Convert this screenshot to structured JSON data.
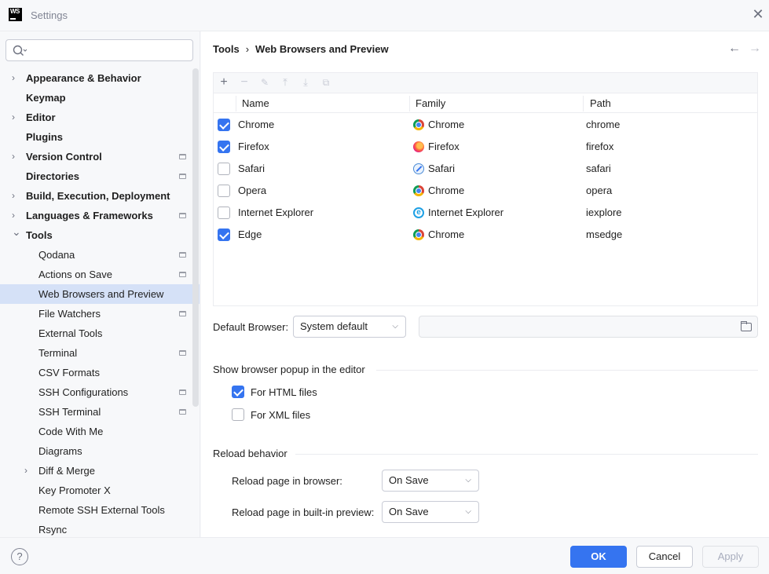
{
  "window": {
    "title": "Settings",
    "logo_text": "WS"
  },
  "search": {
    "placeholder": ""
  },
  "sidebar": {
    "items": [
      {
        "label": "Appearance & Behavior",
        "level": 0,
        "expandable": true,
        "expanded": false,
        "project": false
      },
      {
        "label": "Keymap",
        "level": 0,
        "expandable": false,
        "project": false
      },
      {
        "label": "Editor",
        "level": 0,
        "expandable": true,
        "expanded": false,
        "project": false
      },
      {
        "label": "Plugins",
        "level": 0,
        "expandable": false,
        "project": false
      },
      {
        "label": "Version Control",
        "level": 0,
        "expandable": true,
        "expanded": false,
        "project": true
      },
      {
        "label": "Directories",
        "level": 0,
        "expandable": false,
        "project": true
      },
      {
        "label": "Build, Execution, Deployment",
        "level": 0,
        "expandable": true,
        "expanded": false,
        "project": false
      },
      {
        "label": "Languages & Frameworks",
        "level": 0,
        "expandable": true,
        "expanded": false,
        "project": true
      },
      {
        "label": "Tools",
        "level": 0,
        "expandable": true,
        "expanded": true,
        "project": false
      },
      {
        "label": "Qodana",
        "level": 1,
        "expandable": false,
        "project": true
      },
      {
        "label": "Actions on Save",
        "level": 1,
        "expandable": false,
        "project": true
      },
      {
        "label": "Web Browsers and Preview",
        "level": 1,
        "expandable": false,
        "project": false,
        "selected": true
      },
      {
        "label": "File Watchers",
        "level": 1,
        "expandable": false,
        "project": true
      },
      {
        "label": "External Tools",
        "level": 1,
        "expandable": false,
        "project": false
      },
      {
        "label": "Terminal",
        "level": 1,
        "expandable": false,
        "project": true
      },
      {
        "label": "CSV Formats",
        "level": 1,
        "expandable": false,
        "project": false
      },
      {
        "label": "SSH Configurations",
        "level": 1,
        "expandable": false,
        "project": true
      },
      {
        "label": "SSH Terminal",
        "level": 1,
        "expandable": false,
        "project": true
      },
      {
        "label": "Code With Me",
        "level": 1,
        "expandable": false,
        "project": false
      },
      {
        "label": "Diagrams",
        "level": 1,
        "expandable": false,
        "project": false
      },
      {
        "label": "Diff & Merge",
        "level": 1,
        "expandable": true,
        "expanded": false,
        "project": false
      },
      {
        "label": "Key Promoter X",
        "level": 1,
        "expandable": false,
        "project": false
      },
      {
        "label": "Remote SSH External Tools",
        "level": 1,
        "expandable": false,
        "project": false
      },
      {
        "label": "Rsync",
        "level": 1,
        "expandable": false,
        "project": false
      }
    ]
  },
  "breadcrumb": {
    "parent": "Tools",
    "separator": "›",
    "current": "Web Browsers and Preview"
  },
  "table": {
    "columns": [
      "Name",
      "Family",
      "Path"
    ],
    "rows": [
      {
        "checked": true,
        "name": "Chrome",
        "family": "Chrome",
        "family_icon": "chrome-icon",
        "path": "chrome"
      },
      {
        "checked": true,
        "name": "Firefox",
        "family": "Firefox",
        "family_icon": "firefox-icon",
        "path": "firefox"
      },
      {
        "checked": false,
        "name": "Safari",
        "family": "Safari",
        "family_icon": "safari-icon",
        "path": "safari"
      },
      {
        "checked": false,
        "name": "Opera",
        "family": "Chrome",
        "family_icon": "chrome-icon",
        "path": "opera"
      },
      {
        "checked": false,
        "name": "Internet Explorer",
        "family": "Internet Explorer",
        "family_icon": "ie-icon",
        "path": "iexplore"
      },
      {
        "checked": true,
        "name": "Edge",
        "family": "Chrome",
        "family_icon": "chrome-icon",
        "path": "msedge"
      }
    ]
  },
  "default_browser": {
    "label": "Default Browser:",
    "value": "System default",
    "path_value": ""
  },
  "popup_section": {
    "title": "Show browser popup in the editor",
    "html_label": "For HTML files",
    "html_checked": true,
    "xml_label": "For XML files",
    "xml_checked": false
  },
  "reload_section": {
    "title": "Reload behavior",
    "browser_label": "Reload page in browser:",
    "browser_value": "On Save",
    "preview_label": "Reload page in built-in preview:",
    "preview_value": "On Save"
  },
  "footer": {
    "help": "?",
    "ok": "OK",
    "cancel": "Cancel",
    "apply": "Apply"
  },
  "colors": {
    "accent": "#3574f0",
    "selection": "#d5e1f7"
  }
}
